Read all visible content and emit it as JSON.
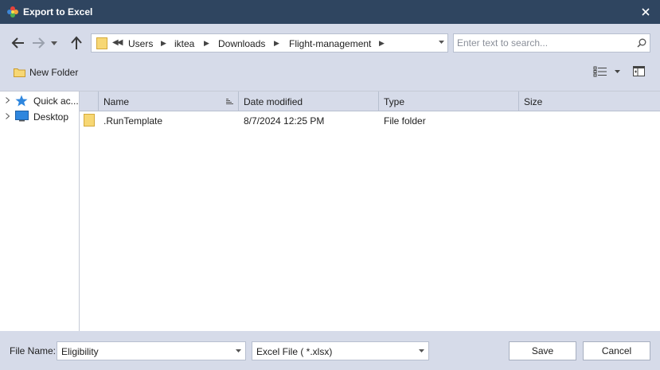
{
  "window": {
    "title": "Export to Excel",
    "colors": {
      "titlebar": "#2f4560",
      "chrome": "#d6dbe9",
      "folder": "#f7d774"
    }
  },
  "nav": {
    "back_icon": "arrow-left-icon",
    "forward_icon": "arrow-right-icon",
    "recent_icon": "chevron-down-icon",
    "up_icon": "arrow-up-icon"
  },
  "address": {
    "crumbs": [
      "Users",
      "iktea",
      "Downloads",
      "Flight-management"
    ]
  },
  "search": {
    "placeholder": "Enter text to search..."
  },
  "toolbar": {
    "new_folder_label": "New Folder"
  },
  "tree": {
    "items": [
      {
        "label": "Quick ac...",
        "icon": "star-icon"
      },
      {
        "label": "Desktop",
        "icon": "desktop-icon"
      }
    ]
  },
  "filelist": {
    "columns": [
      "Name",
      "Date modified",
      "Type",
      "Size"
    ],
    "rows": [
      {
        "name": ".RunTemplate",
        "modified": "8/7/2024 12:25 PM",
        "type": "File folder",
        "size": ""
      }
    ]
  },
  "footer": {
    "file_name_label": "File Name:",
    "file_name_value": "Eligibility",
    "file_type": "Excel File  ( *.xlsx)",
    "save_label": "Save",
    "cancel_label": "Cancel"
  }
}
